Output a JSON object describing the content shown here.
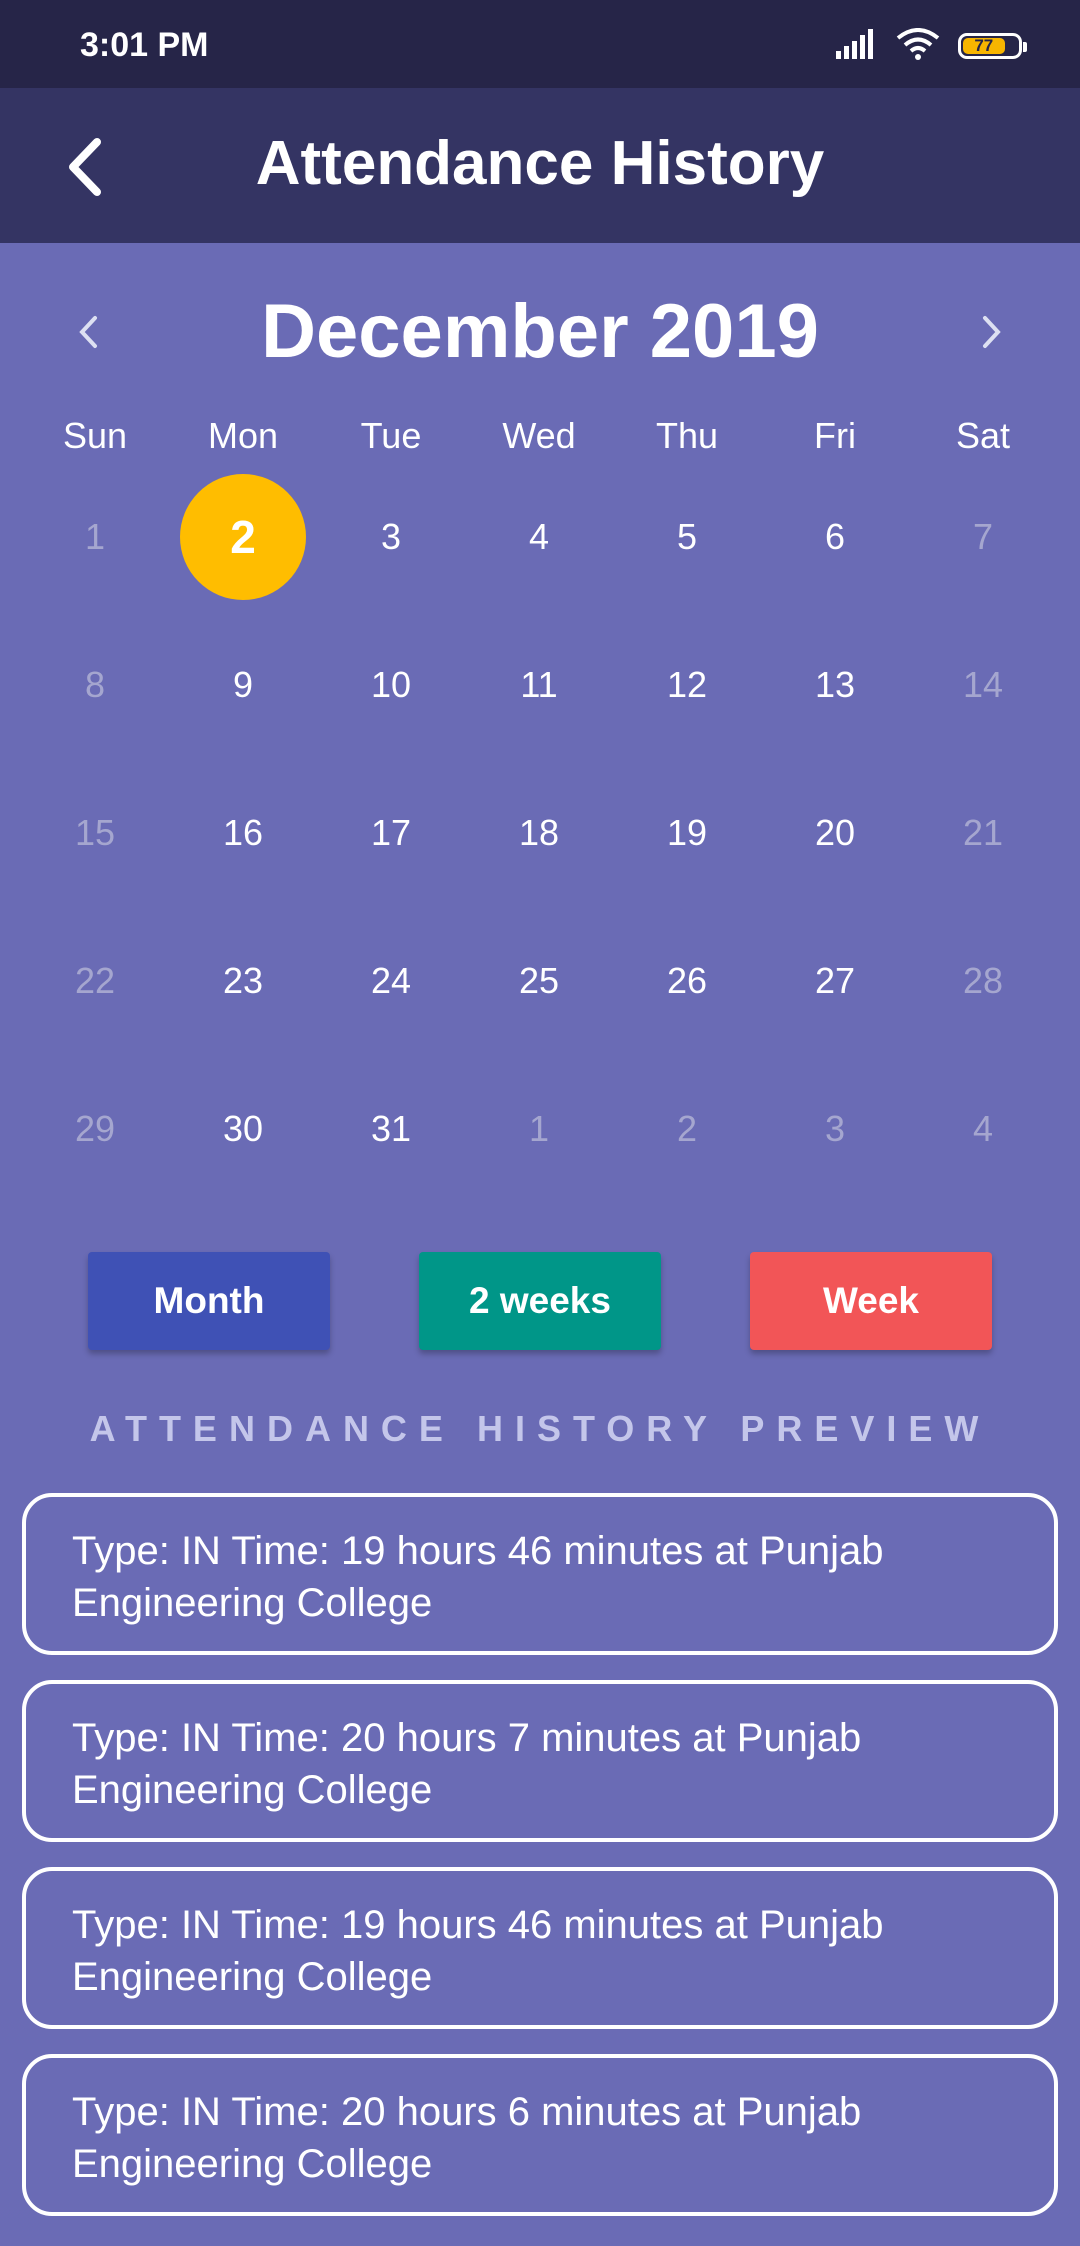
{
  "status_bar": {
    "time": "3:01 PM",
    "battery": "77"
  },
  "app_bar": {
    "title": "Attendance History"
  },
  "calendar": {
    "month_title": "December 2019",
    "weekdays": [
      "Sun",
      "Mon",
      "Tue",
      "Wed",
      "Thu",
      "Fri",
      "Sat"
    ],
    "weeks": [
      [
        "1",
        "2",
        "3",
        "4",
        "5",
        "6",
        "7"
      ],
      [
        "8",
        "9",
        "10",
        "11",
        "12",
        "13",
        "14"
      ],
      [
        "15",
        "16",
        "17",
        "18",
        "19",
        "20",
        "21"
      ],
      [
        "22",
        "23",
        "24",
        "25",
        "26",
        "27",
        "28"
      ],
      [
        "29",
        "30",
        "31",
        "1",
        "2",
        "3",
        "4"
      ]
    ],
    "selected_day": "2"
  },
  "range_buttons": {
    "month": "Month",
    "two_weeks": "2 weeks",
    "week": "Week"
  },
  "section_label": "ATTENDANCE HISTORY PREVIEW",
  "history": [
    "Type: IN Time: 19 hours 46 minutes at Punjab Engineering College",
    "Type: IN Time: 20 hours 7 minutes at Punjab Engineering College",
    "Type: IN Time: 19 hours 46 minutes at Punjab Engineering College",
    "Type: IN Time: 20 hours 6 minutes at Punjab Engineering College"
  ],
  "colors": {
    "background": "#6a6bb5",
    "app_bar": "#343463",
    "status_bar": "#262548",
    "selected": "#ffbd00",
    "month_button": "#3f51b5",
    "two_weeks_button": "#009688",
    "week_button": "#f25557"
  }
}
